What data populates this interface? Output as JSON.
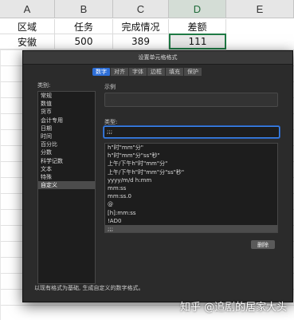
{
  "dialog": {
    "title": "设置单元格格式",
    "tabs": [
      "数字",
      "对齐",
      "字体",
      "边框",
      "填充",
      "保护"
    ],
    "active_tab": "数字",
    "category_label": "类别:",
    "categories": [
      "常规",
      "数值",
      "货币",
      "会计专用",
      "日期",
      "时间",
      "百分比",
      "分数",
      "科学记数",
      "文本",
      "特殊",
      "自定义"
    ],
    "active_category": "自定义",
    "sample_label": "示例",
    "type_label": "类型:",
    "type_value": ";;;",
    "formats": [
      "h\"时\"mm\"分\"",
      "h\"时\"mm\"分\"ss\"秒\"",
      "上午/下午h\"时\"mm\"分\"",
      "上午/下午h\"时\"mm\"分\"ss\"秒\"",
      "yyyy/m/d h:mm",
      "mm:ss",
      "mm:ss.0",
      "@",
      "[h]:mm:ss",
      "!AD0",
      ";;;"
    ],
    "delete_label": "删除",
    "hint": "以现有格式为基础, 生成自定义的数字格式。"
  },
  "sheet": {
    "columns": [
      "A",
      "B",
      "C",
      "D",
      "E"
    ],
    "headers": [
      "区域",
      "任务",
      "完成情况",
      "差额"
    ],
    "row1": [
      "安徽",
      "500",
      "389",
      "111"
    ]
  },
  "watermark": "知乎 @追剧的居家大头"
}
